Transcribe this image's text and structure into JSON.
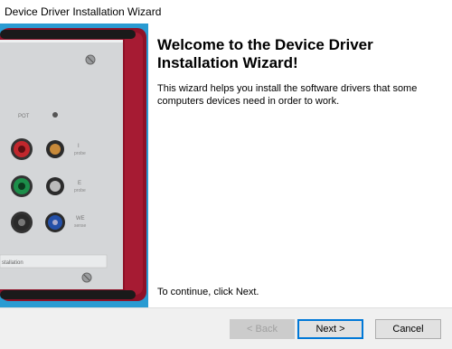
{
  "window": {
    "title": "Device Driver Installation Wizard"
  },
  "side_image": {
    "description_labels": {
      "pot": "POT",
      "i_label": "I",
      "i_sub": "probe",
      "e_label": "E",
      "e_sub": "probe",
      "we_label": "WE",
      "we_sub": "sense",
      "bottom_strip": "stallation"
    }
  },
  "main": {
    "heading": "Welcome to the Device Driver Installation Wizard!",
    "intro": "This wizard helps you install the software drivers that some computers devices need in order to work.",
    "continue": "To continue, click Next."
  },
  "footer": {
    "back_label": "< Back",
    "next_label": "Next >",
    "cancel_label": "Cancel"
  },
  "colors": {
    "accent_focus": "#0078d7",
    "panel_blue": "#2a9bd2",
    "device_red": "#8f1228"
  }
}
